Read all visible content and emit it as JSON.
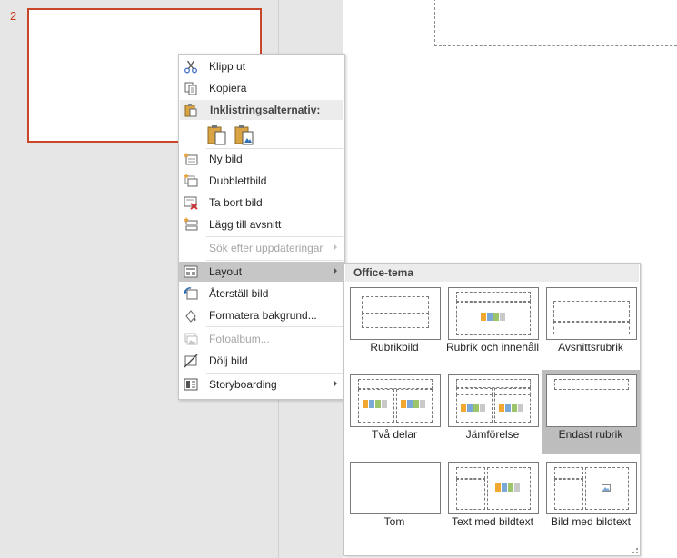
{
  "slide_number": "2",
  "context_menu": {
    "cut": "Klipp ut",
    "copy": "Kopiera",
    "paste_options": "Inklistringsalternativ:",
    "new_slide": "Ny bild",
    "duplicate_slide": "Dubblettbild",
    "delete_slide": "Ta bort bild",
    "add_section": "Lägg till avsnitt",
    "check_updates": "Sök efter uppdateringar",
    "layout": "Layout",
    "reset_slide": "Återställ bild",
    "format_background": "Formatera bakgrund...",
    "photo_album": "Fotoalbum...",
    "hide_slide": "Dölj bild",
    "storyboarding": "Storyboarding"
  },
  "layout_menu": {
    "header": "Office-tema",
    "layouts": [
      {
        "name": "Rubrikbild"
      },
      {
        "name": "Rubrik och innehåll"
      },
      {
        "name": "Avsnittsrubrik"
      },
      {
        "name": "Två delar"
      },
      {
        "name": "Jämförelse"
      },
      {
        "name": "Endast rubrik",
        "selected": true
      },
      {
        "name": "Tom"
      },
      {
        "name": "Text med bildtext"
      },
      {
        "name": "Bild med bildtext"
      }
    ]
  },
  "colors": {
    "accent": "#c8472a",
    "highlight": "#c6c6c6"
  },
  "icons": [
    "scissors-icon",
    "copy-icon",
    "paste-icon",
    "paste-keep-source-icon",
    "paste-picture-icon",
    "new-slide-icon",
    "duplicate-slide-icon",
    "delete-slide-icon",
    "add-section-icon",
    "check-updates-icon",
    "layout-icon",
    "reset-slide-icon",
    "format-background-icon",
    "photo-album-icon",
    "hide-slide-icon",
    "storyboarding-icon"
  ]
}
